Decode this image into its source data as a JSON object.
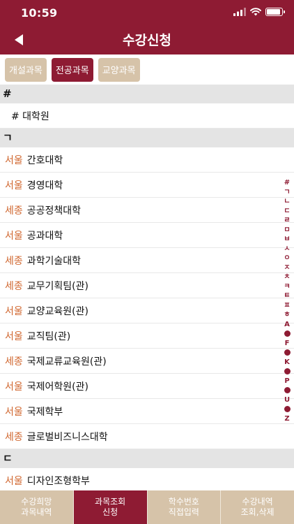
{
  "status": {
    "time": "10:59",
    "battery_level": 0.9
  },
  "nav": {
    "title": "수강신청",
    "back_icon": "back-arrow-icon"
  },
  "tabs": [
    {
      "label": "개설과목",
      "active": false
    },
    {
      "label": "전공과목",
      "active": true
    },
    {
      "label": "교양과목",
      "active": false
    }
  ],
  "list": {
    "sections": [
      {
        "header": "#",
        "rows": [
          {
            "campus": "",
            "name": "# 대학원"
          }
        ]
      },
      {
        "header": "ㄱ",
        "rows": [
          {
            "campus": "서울",
            "name": "간호대학"
          },
          {
            "campus": "서울",
            "name": "경영대학"
          },
          {
            "campus": "세종",
            "name": "공공정책대학"
          },
          {
            "campus": "서울",
            "name": "공과대학"
          },
          {
            "campus": "세종",
            "name": "과학기술대학"
          },
          {
            "campus": "세종",
            "name": "교무기획팀(관)"
          },
          {
            "campus": "서울",
            "name": "교양교육원(관)"
          },
          {
            "campus": "서울",
            "name": "교직팀(관)"
          },
          {
            "campus": "세종",
            "name": "국제교류교육원(관)"
          },
          {
            "campus": "서울",
            "name": "국제어학원(관)"
          },
          {
            "campus": "서울",
            "name": "국제학부"
          },
          {
            "campus": "세종",
            "name": "글로벌비즈니스대학"
          }
        ]
      },
      {
        "header": "ㄷ",
        "rows": [
          {
            "campus": "서울",
            "name": "디자인조형학부"
          }
        ]
      }
    ]
  },
  "index_bar": [
    "#",
    "ㄱ",
    "ㄴ",
    "ㄷ",
    "ㄹ",
    "ㅁ",
    "ㅂ",
    "ㅅ",
    "ㅇ",
    "ㅈ",
    "ㅊ",
    "ㅋ",
    "ㅌ",
    "ㅍ",
    "ㅎ",
    "A",
    "•",
    "F",
    "•",
    "K",
    "•",
    "P",
    "•",
    "U",
    "•",
    "Z"
  ],
  "bottom_tabs": [
    {
      "line1": "수강희망",
      "line2": "과목내역",
      "active": false
    },
    {
      "line1": "과목조회",
      "line2": "신청",
      "active": true
    },
    {
      "line1": "학수번호",
      "line2": "직접입력",
      "active": false
    },
    {
      "line1": "수강내역",
      "line2": "조회,삭제",
      "active": false
    }
  ],
  "colors": {
    "primary": "#8e1b33",
    "tab_inactive": "#d6c3a9",
    "campus": "#d0662e",
    "section_bg": "#e4e4e4"
  }
}
